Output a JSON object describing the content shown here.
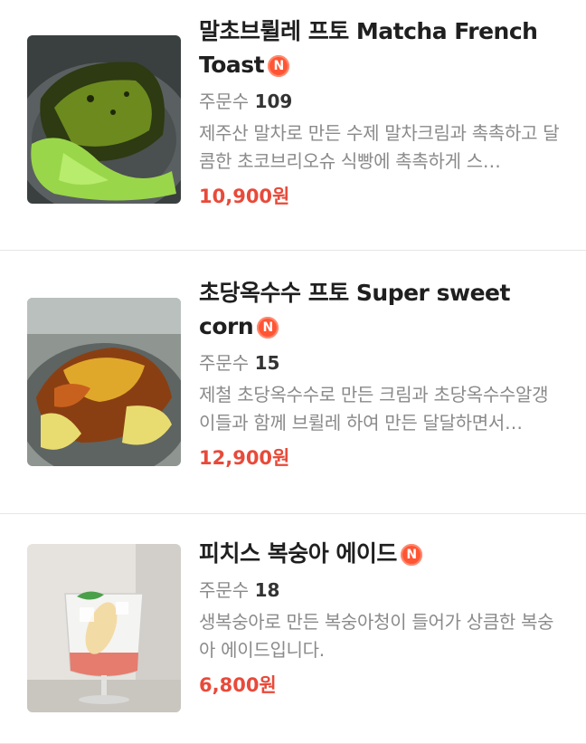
{
  "menu_items": [
    {
      "title": "말초브륄레 프토 Matcha French Toast",
      "badge": "N",
      "orders_label": "주문수",
      "orders_count": "109",
      "description": "제주산 말차로 만든 수제 말차크림과 촉촉하고 달콤한 초코브리오슈 식빵에 촉촉하게 스…",
      "price": "10,900원"
    },
    {
      "title": "초당옥수수 프토 Super sweet corn",
      "badge": "N",
      "orders_label": "주문수",
      "orders_count": "15",
      "description": "제철 초당옥수수로 만든 크림과 초당옥수수알갱이들과 함께 브륄레 하여 만든 달달하면서…",
      "price": "12,900원"
    },
    {
      "title": "피치스 복숭아 에이드",
      "badge": "N",
      "orders_label": "주문수",
      "orders_count": "18",
      "description": "생복숭아로 만든 복숭아청이 들어가 상큼한 복숭아 에이드입니다.",
      "price": "6,800원"
    }
  ],
  "colors": {
    "price": "#e84a3a",
    "badge": "#ff5533",
    "muted_text": "#8a8a8a",
    "divider": "#e6e6e6"
  }
}
